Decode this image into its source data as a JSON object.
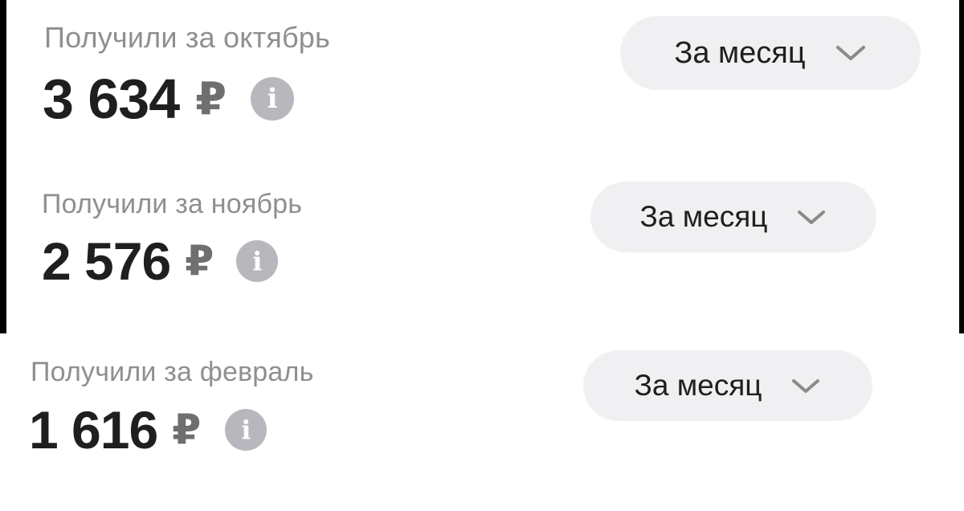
{
  "currency_symbol": "₽",
  "period_selector_label": "За месяц",
  "cards": [
    {
      "label": "Получили за октябрь",
      "amount": "3 634"
    },
    {
      "label": "Получили за ноябрь",
      "amount": "2 576"
    },
    {
      "label": "Получили за февраль",
      "amount": "1 616"
    }
  ],
  "icons": {
    "info": "info-icon",
    "dropdown": "chevron-down-icon"
  },
  "colors": {
    "background": "#ffffff",
    "label_text": "#8f8f8f",
    "amount_text": "#1f1f1f",
    "currency_text": "#6f6f6f",
    "info_icon_bg": "#b7b7bd",
    "button_bg": "#f0f0f2"
  }
}
